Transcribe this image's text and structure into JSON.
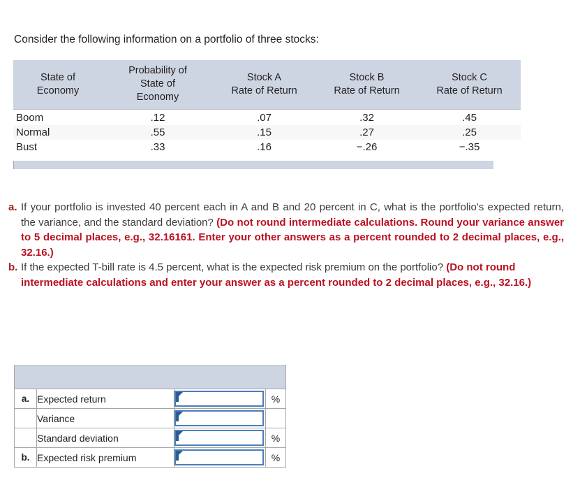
{
  "intro": {
    "text": "Consider the following information on a portfolio of three stocks:"
  },
  "data_table": {
    "headers": [
      "State of\nEconomy",
      "Probability of\nState of\nEconomy",
      "Stock A\nRate of Return",
      "Stock B\nRate of Return",
      "Stock C\nRate of Return"
    ],
    "headers_lines": {
      "h0_l1": "State of",
      "h0_l2": "Economy",
      "h1_l1": "Probability of",
      "h1_l2": "State of",
      "h1_l3": "Economy",
      "h2_l1": "Stock A",
      "h2_l2": "Rate of Return",
      "h3_l1": "Stock B",
      "h3_l2": "Rate of Return",
      "h4_l1": "Stock C",
      "h4_l2": "Rate of Return"
    },
    "rows": [
      {
        "state": "Boom",
        "probability": ".12",
        "stock_a": ".07",
        "stock_b": ".32",
        "stock_c": ".45"
      },
      {
        "state": "Normal",
        "probability": ".55",
        "stock_a": ".15",
        "stock_b": ".27",
        "stock_c": ".25"
      },
      {
        "state": "Bust",
        "probability": ".33",
        "stock_a": ".16",
        "stock_b": "−.26",
        "stock_c": "−.35"
      }
    ]
  },
  "questions": [
    {
      "marker": "a.",
      "text_plain": "If your portfolio is invested 40 percent each in A and B and 20 percent in C, what is the portfolio's expected return, the variance, and the standard deviation? ",
      "text_red": "(Do not round intermediate calculations. Round your variance answer to 5 decimal places, e.g., 32.16161. Enter your other answers as a percent rounded to 2 decimal places, e.g., 32.16.)"
    },
    {
      "marker": "b.",
      "text_plain": "If the expected T-bill rate is 4.5 percent, what is the expected risk premium on the portfolio? ",
      "text_red": "(Do not round intermediate calculations and enter your answer as a percent rounded to 2 decimal places, e.g., 32.16.)"
    }
  ],
  "answer_table": {
    "rows": [
      {
        "letter": "a.",
        "label": "Expected return",
        "value": "",
        "unit": "%"
      },
      {
        "letter": "",
        "label": "Variance",
        "value": "",
        "unit": ""
      },
      {
        "letter": "",
        "label": "Standard deviation",
        "value": "",
        "unit": "%"
      },
      {
        "letter": "b.",
        "label": "Expected risk premium",
        "value": "",
        "unit": "%"
      }
    ]
  },
  "colors": {
    "header_bg": "#ced5e2",
    "alt_row_bg": "#f7f7f7",
    "red_text": "#bb1122",
    "input_border": "#4a7ebb",
    "marker_red": "#a41d1d"
  }
}
